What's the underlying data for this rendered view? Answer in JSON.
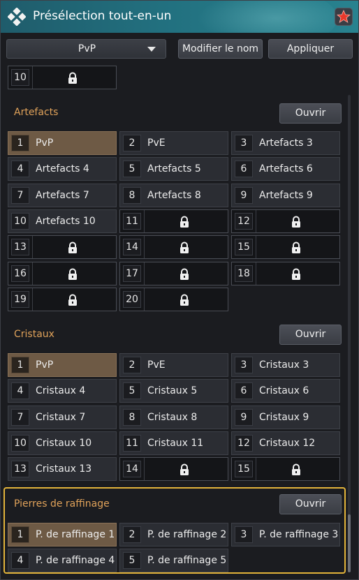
{
  "window": {
    "title": "Présélection tout-en-un"
  },
  "toolbar": {
    "preset_value": "PvP",
    "rename_label": "Modifier le nom",
    "apply_label": "Appliquer"
  },
  "top_partial": {
    "num": "10"
  },
  "artefacts": {
    "title": "Artefacts",
    "open_label": "Ouvrir",
    "slots": [
      {
        "num": "1",
        "label": "PvP",
        "selected": true
      },
      {
        "num": "2",
        "label": "PvE"
      },
      {
        "num": "3",
        "label": "Artefacts 3"
      },
      {
        "num": "4",
        "label": "Artefacts 4"
      },
      {
        "num": "5",
        "label": "Artefacts 5"
      },
      {
        "num": "6",
        "label": "Artefacts 6"
      },
      {
        "num": "7",
        "label": "Artefacts 7"
      },
      {
        "num": "8",
        "label": "Artefacts 8"
      },
      {
        "num": "9",
        "label": "Artefacts 9"
      },
      {
        "num": "10",
        "label": "Artefacts 10"
      },
      {
        "num": "11",
        "locked": true
      },
      {
        "num": "12",
        "locked": true
      },
      {
        "num": "13",
        "locked": true
      },
      {
        "num": "14",
        "locked": true
      },
      {
        "num": "15",
        "locked": true
      },
      {
        "num": "16",
        "locked": true
      },
      {
        "num": "17",
        "locked": true
      },
      {
        "num": "18",
        "locked": true
      },
      {
        "num": "19",
        "locked": true
      },
      {
        "num": "20",
        "locked": true
      }
    ]
  },
  "cristaux": {
    "title": "Cristaux",
    "open_label": "Ouvrir",
    "slots": [
      {
        "num": "1",
        "label": "PvP",
        "selected": true
      },
      {
        "num": "2",
        "label": "PvE"
      },
      {
        "num": "3",
        "label": "Cristaux 3"
      },
      {
        "num": "4",
        "label": "Cristaux 4"
      },
      {
        "num": "5",
        "label": "Cristaux 5"
      },
      {
        "num": "6",
        "label": "Cristaux 6"
      },
      {
        "num": "7",
        "label": "Cristaux 7"
      },
      {
        "num": "8",
        "label": "Cristaux 8"
      },
      {
        "num": "9",
        "label": "Cristaux 9"
      },
      {
        "num": "10",
        "label": "Cristaux 10"
      },
      {
        "num": "11",
        "label": "Cristaux 11"
      },
      {
        "num": "12",
        "label": "Cristaux 12"
      },
      {
        "num": "13",
        "label": "Cristaux 13"
      },
      {
        "num": "14",
        "locked": true
      },
      {
        "num": "15",
        "locked": true
      }
    ]
  },
  "pierres": {
    "title": "Pierres de raffinage",
    "open_label": "Ouvrir",
    "slots": [
      {
        "num": "1",
        "label": "P. de raffinage 1",
        "selected": true
      },
      {
        "num": "2",
        "label": "P. de raffinage 2"
      },
      {
        "num": "3",
        "label": "P. de raffinage 3"
      },
      {
        "num": "4",
        "label": "P. de raffinage 4"
      },
      {
        "num": "5",
        "label": "P. de raffinage 5"
      }
    ]
  },
  "colors": {
    "accent": "#e0a25a",
    "highlight": "#e3b43a",
    "selected_slot": "#6e5a45",
    "title_bar": "#22707f"
  }
}
